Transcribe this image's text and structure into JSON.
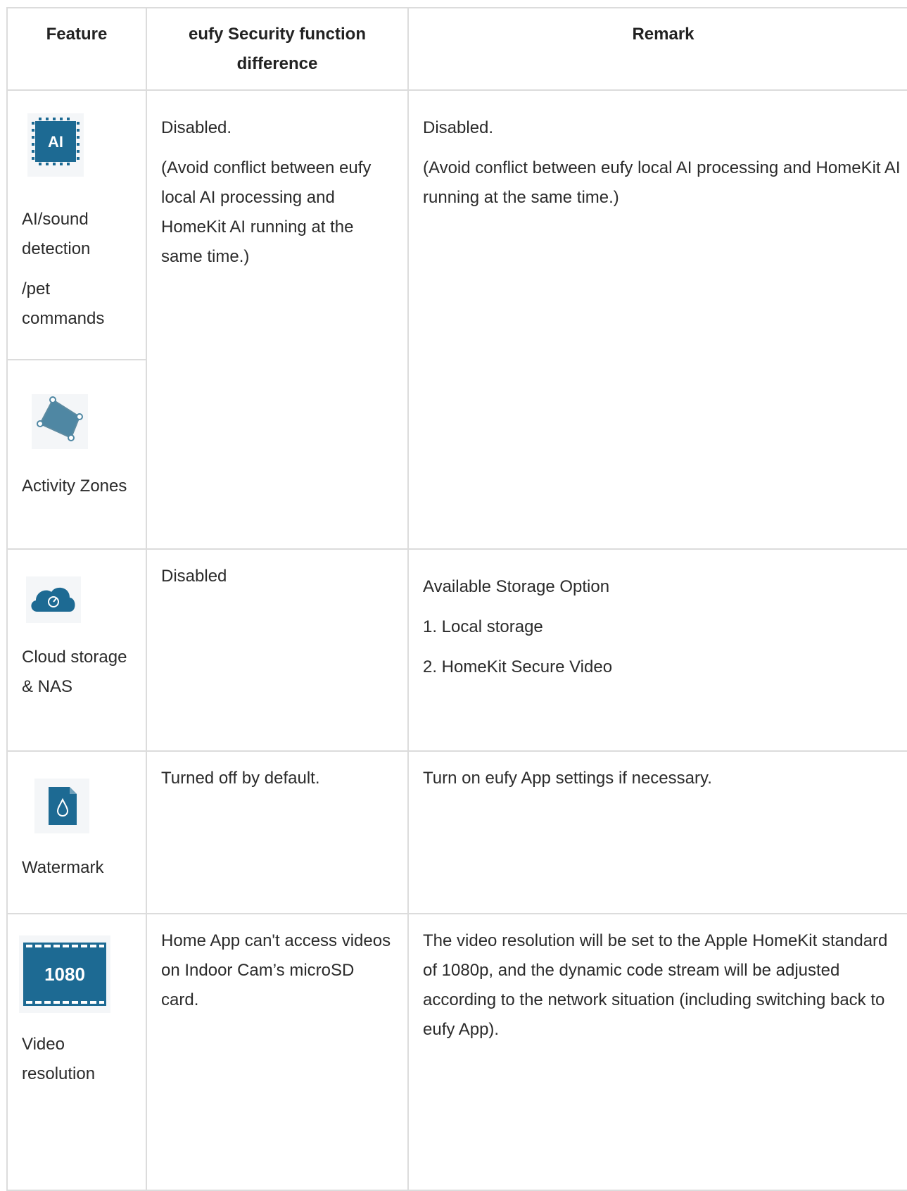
{
  "headers": {
    "feature": "Feature",
    "difference": "eufy Security function difference",
    "remark": "Remark"
  },
  "rows": {
    "ai": {
      "icon": "ai-chip-icon",
      "feature_lines": [
        "AI/sound detection",
        "/pet commands"
      ],
      "difference_lines": [
        "Disabled.",
        "(Avoid conflict between eufy local AI processing and HomeKit AI running at the same time.)"
      ],
      "remark_lines": [
        "Disabled.",
        "(Avoid conflict between eufy local AI processing and HomeKit AI running at the same time.)"
      ]
    },
    "zones": {
      "icon": "activity-zone-icon",
      "feature": "Activity Zones"
    },
    "cloud": {
      "icon": "cloud-icon",
      "feature": "Cloud storage & NAS",
      "difference": "Disabled",
      "remark_lines": [
        "Available Storage Option",
        "1. Local storage",
        "2. HomeKit Secure Video"
      ]
    },
    "watermark": {
      "icon": "watermark-icon",
      "feature": "Watermark",
      "difference": "Turned off by default.",
      "remark": "Turn on eufy App settings if necessary."
    },
    "resolution": {
      "icon": "video-1080-icon",
      "icon_text": "1080",
      "feature": "Video resolution",
      "difference": "Home App can't access videos on Indoor Cam’s microSD card.",
      "remark": "The video resolution will be set to the Apple HomeKit standard of 1080p, and the dynamic code stream will be adjusted according to the network situation (including switching back to eufy App)."
    }
  },
  "colors": {
    "icon_blue": "#1d6a93",
    "border": "#dcdcdc",
    "text": "#2b2b2b"
  }
}
